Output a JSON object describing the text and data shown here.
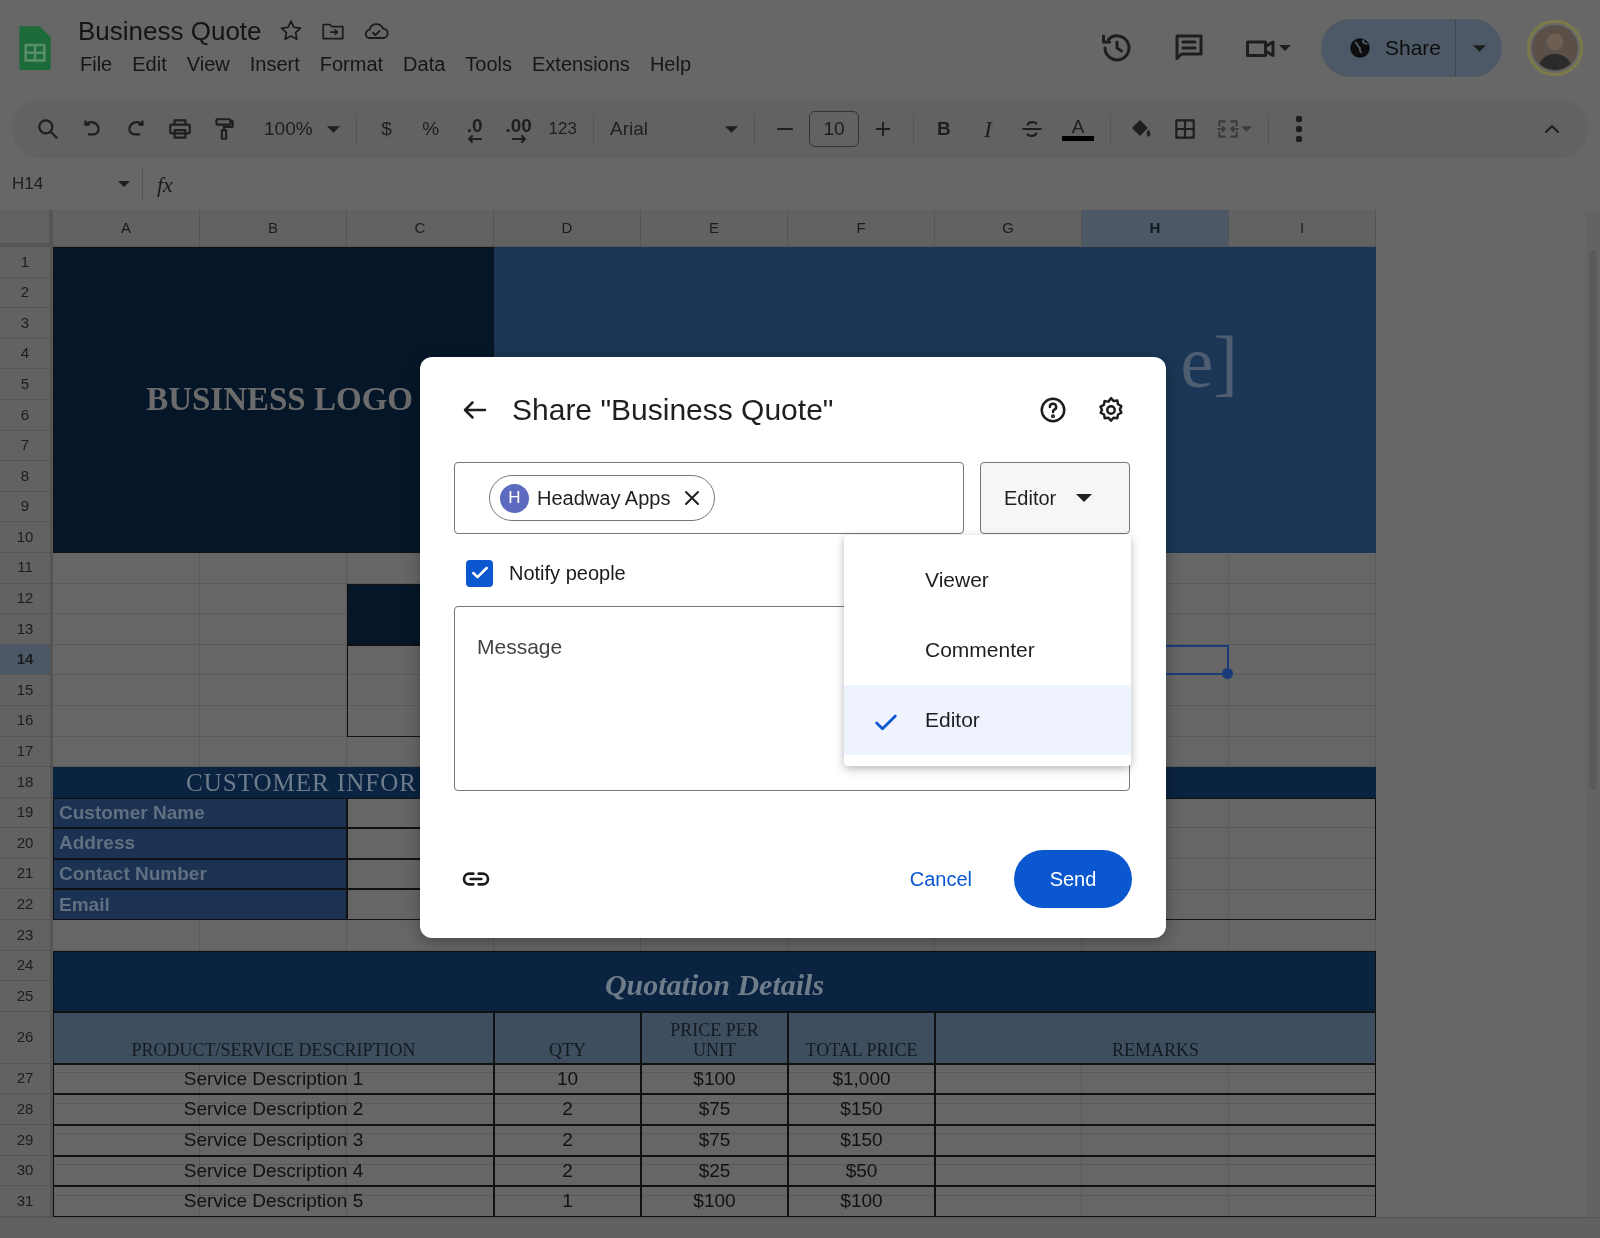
{
  "app": {
    "title": "Business Quote",
    "menu": [
      "File",
      "Edit",
      "View",
      "Insert",
      "Format",
      "Data",
      "Tools",
      "Extensions",
      "Help"
    ],
    "share_label": "Share"
  },
  "toolbar": {
    "zoom": "100%",
    "currency": "$",
    "percent": "%",
    "decrease_decimal": ".0",
    "increase_decimal": ".00",
    "number_format": "123",
    "font": "Arial",
    "font_size": "10",
    "bold": "B",
    "italic": "I",
    "text_color": "A"
  },
  "formula_bar": {
    "cell_ref": "H14",
    "fx": "fx"
  },
  "sheet": {
    "columns": [
      {
        "label": "A",
        "selected": false
      },
      {
        "label": "B",
        "selected": false
      },
      {
        "label": "C",
        "selected": false
      },
      {
        "label": "D",
        "selected": false
      },
      {
        "label": "E",
        "selected": false
      },
      {
        "label": "F",
        "selected": false
      },
      {
        "label": "G",
        "selected": false
      },
      {
        "label": "H",
        "selected": true
      },
      {
        "label": "I",
        "selected": false
      }
    ],
    "rows": [
      {
        "label": "1",
        "selected": false
      },
      {
        "label": "2",
        "selected": false
      },
      {
        "label": "3",
        "selected": false
      },
      {
        "label": "4",
        "selected": false
      },
      {
        "label": "5",
        "selected": false
      },
      {
        "label": "6",
        "selected": false
      },
      {
        "label": "7",
        "selected": false
      },
      {
        "label": "8",
        "selected": false
      },
      {
        "label": "9",
        "selected": false
      },
      {
        "label": "10",
        "selected": false
      },
      {
        "label": "11",
        "selected": false
      },
      {
        "label": "12",
        "selected": false
      },
      {
        "label": "13",
        "selected": false
      },
      {
        "label": "14",
        "selected": true
      },
      {
        "label": "15",
        "selected": false
      },
      {
        "label": "16",
        "selected": false
      },
      {
        "label": "17",
        "selected": false
      },
      {
        "label": "18",
        "selected": false
      },
      {
        "label": "19",
        "selected": false
      },
      {
        "label": "20",
        "selected": false
      },
      {
        "label": "21",
        "selected": false
      },
      {
        "label": "22",
        "selected": false
      },
      {
        "label": "23",
        "selected": false
      },
      {
        "label": "24",
        "selected": false
      },
      {
        "label": "25",
        "selected": false
      },
      {
        "label": "26",
        "selected": false
      },
      {
        "label": "27",
        "selected": false
      },
      {
        "label": "28",
        "selected": false
      },
      {
        "label": "29",
        "selected": false
      },
      {
        "label": "30",
        "selected": false
      },
      {
        "label": "31",
        "selected": false
      }
    ],
    "logo": "BUSINESS LOGO",
    "title_fragment": "e]",
    "customer_header": "CUSTOMER INFOR",
    "customer_fields": [
      "Customer Name",
      "Address",
      "Contact Number",
      "Email"
    ],
    "quote_title": "Quotation Details",
    "table": {
      "columns": [
        "PRODUCT/SERVICE DESCRIPTION",
        "QTY",
        "PRICE PER UNIT",
        "TOTAL PRICE",
        "REMARKS"
      ],
      "rows": [
        [
          "Service Description 1",
          "10",
          "$100",
          "$1,000"
        ],
        [
          "Service Description 2",
          "2",
          "$75",
          "$150"
        ],
        [
          "Service Description 3",
          "2",
          "$75",
          "$150"
        ],
        [
          "Service Description 4",
          "2",
          "$25",
          "$50"
        ],
        [
          "Service Description 5",
          "1",
          "$100",
          "$100"
        ]
      ]
    }
  },
  "dialog": {
    "title": "Share \"Business Quote\"",
    "recipients": [
      {
        "initial": "H",
        "name": "Headway Apps"
      }
    ],
    "role": "Editor",
    "notify": {
      "label": "Notify people",
      "checked": true
    },
    "message": {
      "placeholder": "Message"
    },
    "cancel": "Cancel",
    "send": "Send"
  },
  "role_menu": [
    {
      "label": "Viewer",
      "selected": false
    },
    {
      "label": "Commenter",
      "selected": false
    },
    {
      "label": "Editor",
      "selected": true
    }
  ]
}
